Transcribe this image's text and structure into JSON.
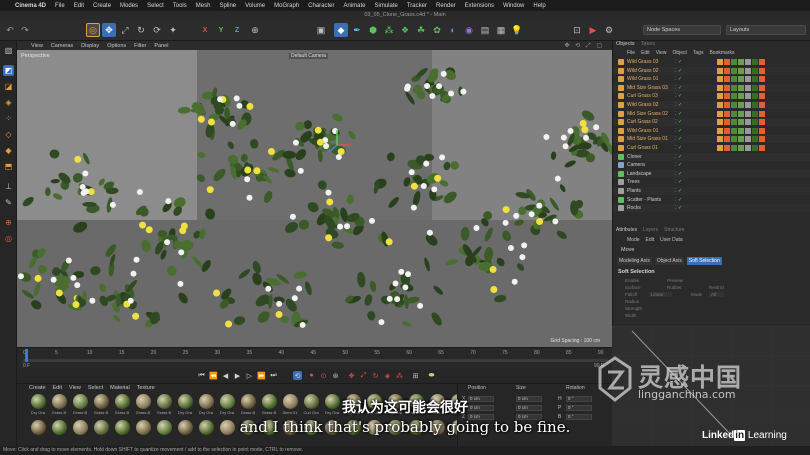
{
  "macmenu": {
    "app": "Cinema 4D",
    "items": [
      "File",
      "Edit",
      "Create",
      "Modes",
      "Select",
      "Tools",
      "Mesh",
      "Spline",
      "Volume",
      "MoGraph",
      "Character",
      "Animate",
      "Simulate",
      "Tracker",
      "Render",
      "Extensions",
      "Window",
      "Help"
    ]
  },
  "window": {
    "title": "03_05_Clone_Grass.c4d * - Main"
  },
  "toolbar": {
    "node_spaces": "Node Spaces",
    "layouts": "Layouts"
  },
  "viewport": {
    "menu": [
      "View",
      "Cameras",
      "Display",
      "Options",
      "Filter",
      "Panel"
    ],
    "label": "Perspective",
    "camera_label": "Default Camera",
    "grid_spacing": "Grid Spacing : 100 cm"
  },
  "timeline": {
    "ticks": [
      "0",
      "5",
      "10",
      "15",
      "20",
      "25",
      "30",
      "35",
      "40",
      "45",
      "50",
      "55",
      "60",
      "65",
      "70",
      "75",
      "80",
      "85",
      "90"
    ],
    "start": "0 F",
    "end": "90 F"
  },
  "objects_panel": {
    "tabs": [
      "Objects",
      "Takes"
    ],
    "menu": [
      "File",
      "Edit",
      "View",
      "Object",
      "Tags",
      "Bookmarks"
    ],
    "items": [
      {
        "name": "Wild Grass 03",
        "color": "#e0a040"
      },
      {
        "name": "Wild Grass 02",
        "color": "#e0a040"
      },
      {
        "name": "Wild Grass 01",
        "color": "#e0a040"
      },
      {
        "name": "Mid Size Grass 03",
        "color": "#e0a040"
      },
      {
        "name": "Curl Grass 03",
        "color": "#e0a040"
      },
      {
        "name": "Wild Grass 02",
        "color": "#e0a040"
      },
      {
        "name": "Mid Size Grass 02",
        "color": "#e0a040"
      },
      {
        "name": "Curl Grass 02",
        "color": "#e0a040"
      },
      {
        "name": "Wild Grass 01",
        "color": "#e0a040"
      },
      {
        "name": "Mid Size Grass 01",
        "color": "#e0a040"
      },
      {
        "name": "Curl Grass 01",
        "color": "#e0a040"
      },
      {
        "name": "Cloner",
        "color": "#5fbf5f"
      },
      {
        "name": "Camera",
        "color": "#8aa0d0"
      },
      {
        "name": "Landscape",
        "color": "#5fbf5f"
      },
      {
        "name": "Trees",
        "color": "#a0a0a0"
      },
      {
        "name": "Plants",
        "color": "#a0a0a0"
      },
      {
        "name": "Scatter - Plants",
        "color": "#5fbf5f"
      },
      {
        "name": "Rocks",
        "color": "#a0a0a0"
      }
    ]
  },
  "attributes_panel": {
    "tabs": [
      "Attributes",
      "Layers",
      "Structure"
    ],
    "menu": [
      "Mode",
      "Edit",
      "User Data"
    ],
    "title": "Move",
    "subtabs": [
      "Modeling Axis",
      "Object Axis",
      "Soft Selection"
    ],
    "active_subtab": "Soft Selection",
    "section": "Soft Selection",
    "fields": [
      "Enable",
      "Preview",
      "Surface",
      "Rubber",
      "Restrict",
      "Falloff",
      "Linear",
      "Mode",
      "All",
      "Radius",
      "Strength",
      "Width"
    ]
  },
  "materials": {
    "menu": [
      "Create",
      "Edit",
      "View",
      "Select",
      "Material",
      "Texture"
    ],
    "row1": [
      "Dry Gra",
      "Grass B",
      "Grass B",
      "Grass B",
      "Grass B",
      "Grass B",
      "Grass B",
      "Dry Gra",
      "Dry Gra",
      "Dry Gra",
      "Grass B",
      "Grass B",
      "Stem 01",
      "Curl Gra",
      "Dry Gra",
      "Dry Gra",
      "Dry Gra",
      "Dry Gra",
      "Dry Gra",
      "Grass B",
      "Grass B"
    ],
    "row2": [
      "",
      "",
      "",
      "",
      "",
      "",
      "",
      "",
      "",
      "",
      "",
      "",
      "",
      "",
      "",
      "",
      "",
      "",
      "",
      "",
      ""
    ]
  },
  "coordinates": {
    "headers": [
      "Position",
      "Size",
      "Rotation"
    ],
    "rows": [
      {
        "axis": "X",
        "pos": "0 cm",
        "size": "0 cm",
        "rot_label": "H",
        "rot": "0 °"
      },
      {
        "axis": "Y",
        "pos": "0 cm",
        "size": "0 cm",
        "rot_label": "P",
        "rot": "0 °"
      },
      {
        "axis": "Z",
        "pos": "0 cm",
        "size": "0 cm",
        "rot_label": "B",
        "rot": "0 °"
      }
    ]
  },
  "status": "Move: Click and drag to move elements. Hold down SHIFT to quantize movement / add to the selection in point mode, CTRL to remove.",
  "subtitles": {
    "cn": "我认为这可能会很好",
    "en": "and I think that's probably going to be fine."
  },
  "watermark": {
    "text": "灵感中国",
    "url": "lingganchina.com"
  },
  "brand": {
    "linkedin": "Linked",
    "in": "in",
    "learning": " Learning"
  },
  "colors": {
    "accent": "#3a6fb5",
    "object_orange": "#e0a040",
    "object_green": "#5fbf5f"
  }
}
